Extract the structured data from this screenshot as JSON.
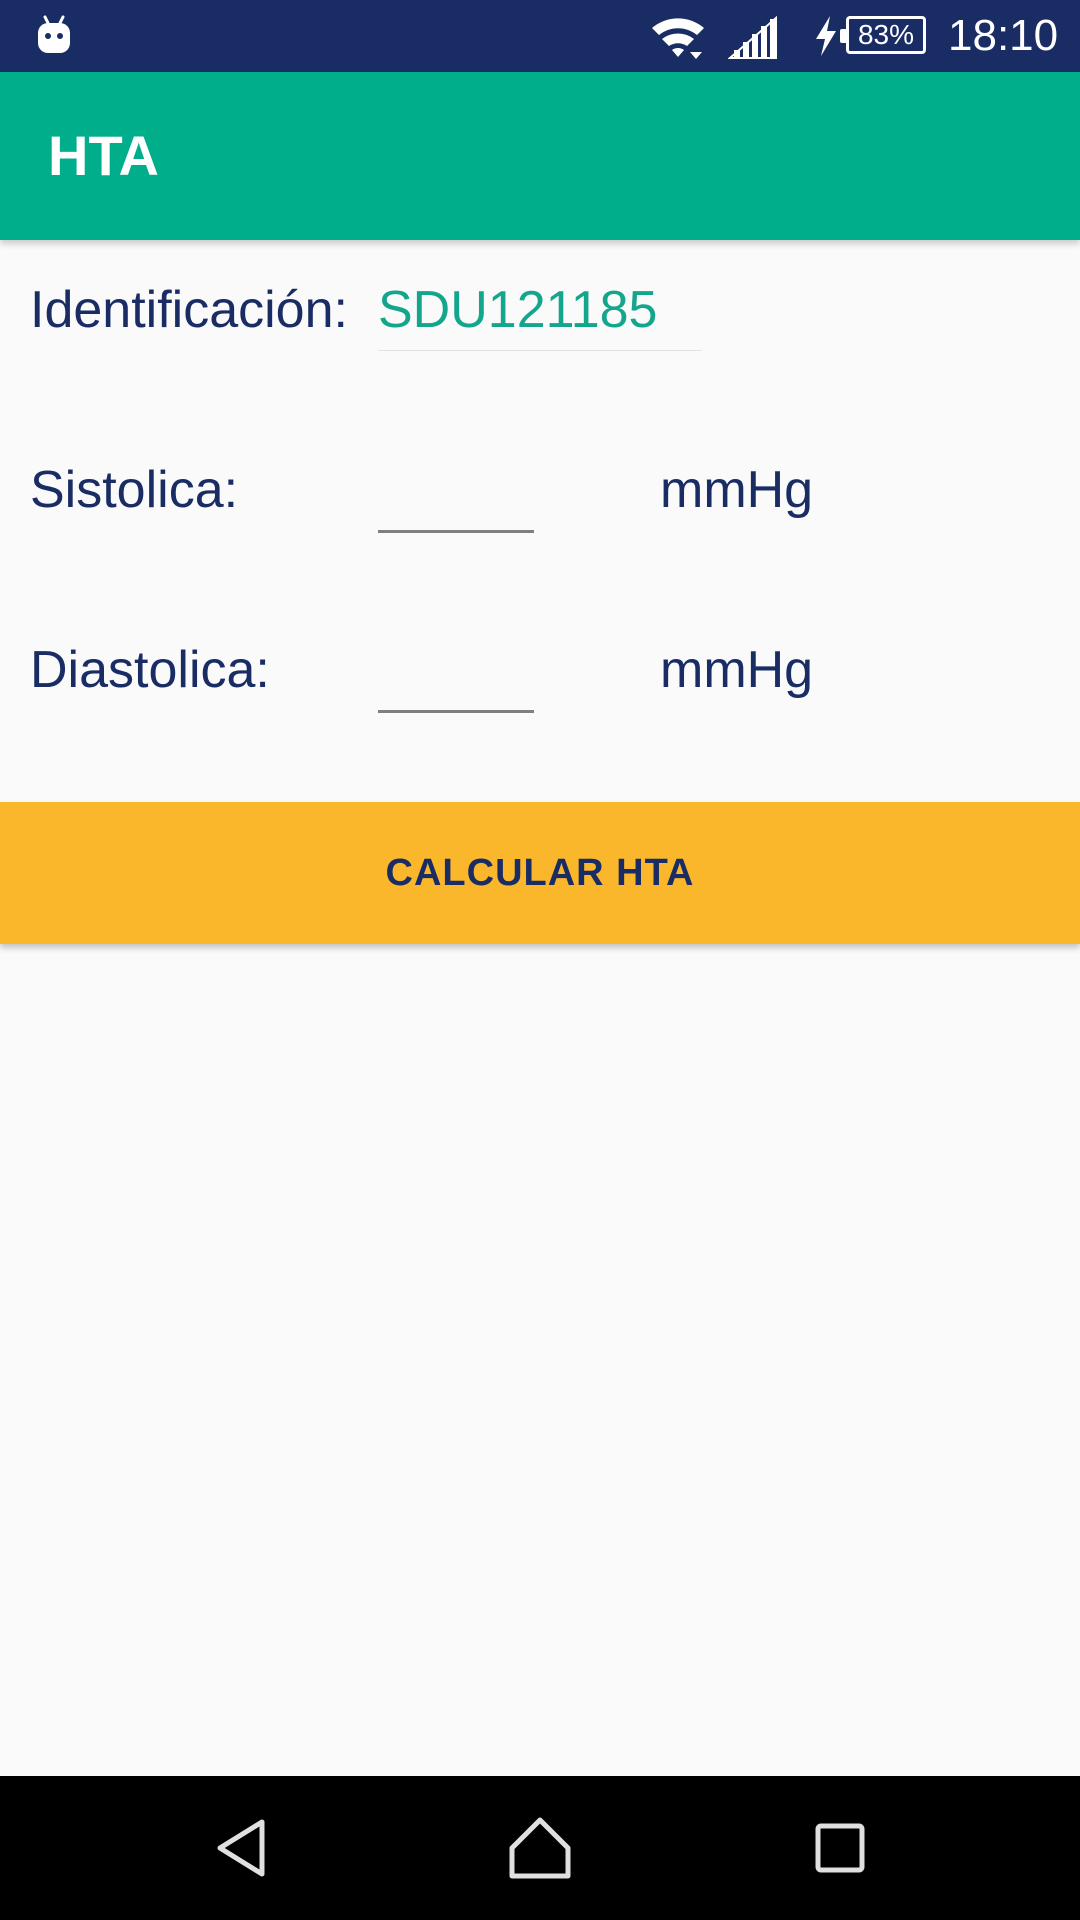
{
  "status_bar": {
    "battery_percent": "83%",
    "clock": "18:10",
    "icons": [
      "android-robot-icon",
      "wifi-icon",
      "cell-signal-icon",
      "charging-icon",
      "battery-icon"
    ],
    "background_color": "#1a2c64"
  },
  "app_bar": {
    "title": "HTA",
    "background_color": "#00ae8c"
  },
  "form": {
    "identification": {
      "label": "Identificación:",
      "value": "SDU121185"
    },
    "systolic": {
      "label": "Sistolica:",
      "value": "",
      "unit": "mmHg"
    },
    "diastolic": {
      "label": "Diastolica:",
      "value": "",
      "unit": "mmHg"
    }
  },
  "actions": {
    "calculate_label": "CALCULAR HTA",
    "button_color": "#fbb72b"
  },
  "nav_bar": {
    "icons": [
      "back-icon",
      "home-icon",
      "recents-icon"
    ]
  },
  "colors": {
    "text_primary": "#1a2c64",
    "accent": "#13a68c",
    "background": "#fafafa"
  }
}
